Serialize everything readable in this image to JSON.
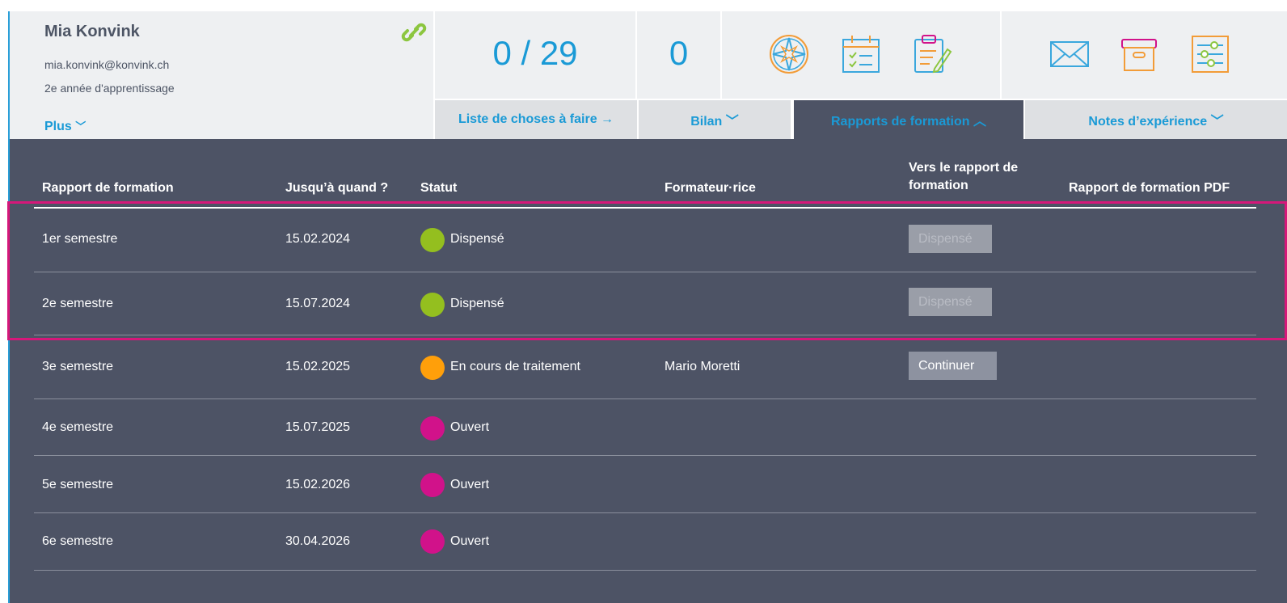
{
  "profile": {
    "name": "Mia Konvink",
    "email": "mia.konvink@konvink.ch",
    "year": "2e année d'apprentissage",
    "more_label": "Plus",
    "more_chevron": "﹀"
  },
  "stats": {
    "fraction": "0 / 29",
    "count": "0"
  },
  "icons": [
    "link-icon",
    "compass-icon",
    "calendar-checklist-icon",
    "clipboard-edit-icon",
    "mail-icon",
    "archive-box-icon",
    "settings-sliders-icon"
  ],
  "tabs": [
    {
      "label": "Liste de choses à faire →"
    },
    {
      "label": "Bilan ﹀"
    },
    {
      "label": "Rapports de formation ︿"
    },
    {
      "label": "Notes d’expérience ﹀"
    }
  ],
  "table": {
    "headers": {
      "report": "Rapport de formation",
      "until": "Jusqu’à quand ?",
      "status": "Statut",
      "trainer": "Formateur·rice",
      "to_report_line1": "Vers le rapport de",
      "to_report_line2": "formation",
      "pdf": "Rapport de formation PDF"
    },
    "rows": [
      {
        "report": "1er semestre",
        "until": "15.02.2024",
        "status": "Dispensé",
        "status_color": "#94bf1f",
        "trainer": "",
        "action": "Dispensé"
      },
      {
        "report": "2e semestre",
        "until": "15.07.2024",
        "status": "Dispensé",
        "status_color": "#94bf1f",
        "trainer": "",
        "action": "Dispensé"
      },
      {
        "report": "3e semestre",
        "until": "15.02.2025",
        "status": "En cours de traitement",
        "status_color": "#ff9f0a",
        "trainer": "Mario Moretti",
        "action": "Continuer"
      },
      {
        "report": "4e semestre",
        "until": "15.07.2025",
        "status": "Ouvert",
        "status_color": "#d1128a",
        "trainer": "",
        "action": ""
      },
      {
        "report": "5e semestre",
        "until": "15.02.2026",
        "status": "Ouvert",
        "status_color": "#d1128a",
        "trainer": "",
        "action": ""
      },
      {
        "report": "6e semestre",
        "until": "30.04.2026",
        "status": "Ouvert",
        "status_color": "#d1128a",
        "trainer": "",
        "action": ""
      }
    ]
  },
  "colors": {
    "accent": "#1a9ad6",
    "panel": "#4d5365",
    "highlight": "#d6177a"
  }
}
